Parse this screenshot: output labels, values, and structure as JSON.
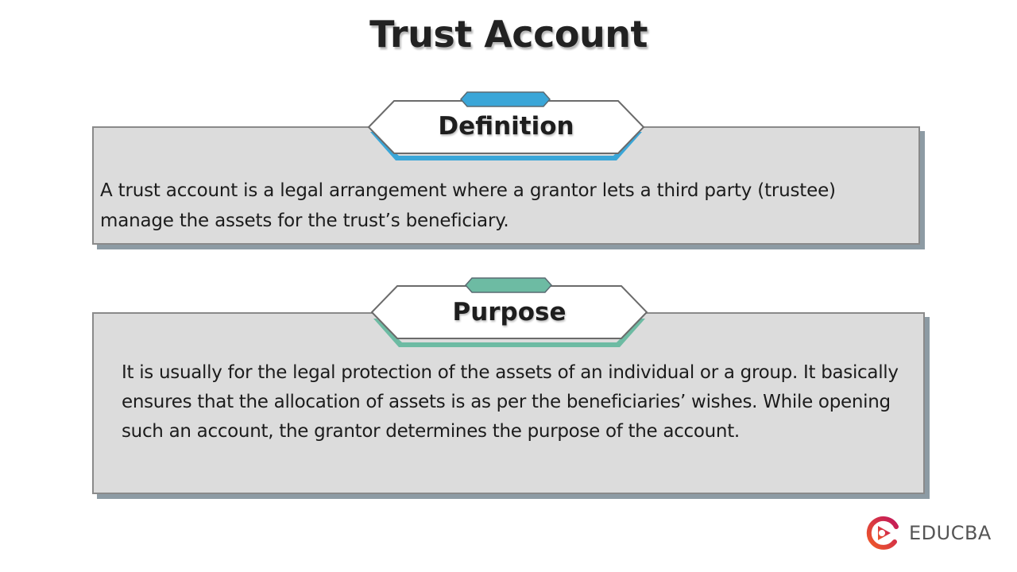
{
  "title": "Trust Account",
  "sections": [
    {
      "id": "definition",
      "heading": "Definition",
      "accent_color": "#3aa6d8",
      "body": "A trust account is a legal arrangement where a grantor lets a third party (trustee) manage the assets for the trust’s beneficiary."
    },
    {
      "id": "purpose",
      "heading": "Purpose",
      "accent_color": "#6dbba3",
      "body": "It is usually for the legal protection of the assets of an individual or a group. It basically ensures that the allocation of assets is as per the beneficiaries’ wishes. While opening such an account, the grantor determines the purpose of the account."
    }
  ],
  "brand": {
    "name": "EDUCBA",
    "icon": "educba-logo-icon",
    "colors": [
      "#e8413b",
      "#c2185b"
    ]
  }
}
